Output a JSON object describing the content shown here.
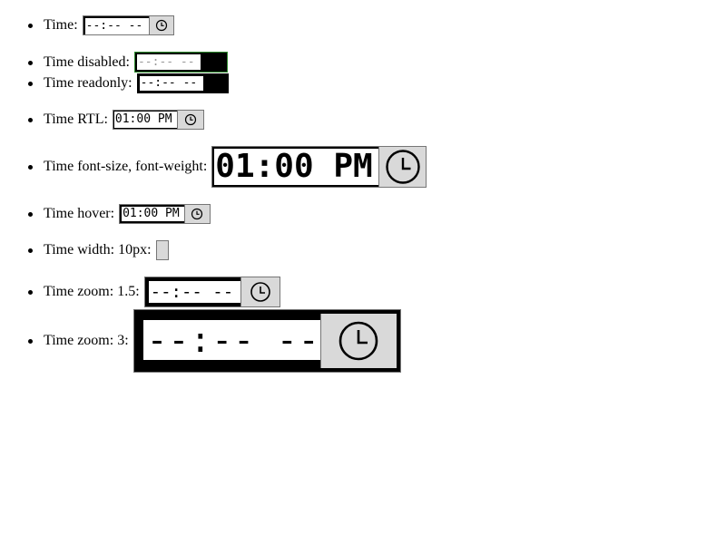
{
  "items": [
    {
      "label": "Time:",
      "value": "--:-- --",
      "icon": "clock-icon"
    },
    {
      "label": "Time disabled:",
      "value": "--:-- --"
    },
    {
      "label": "Time readonly:",
      "value": "--:-- --"
    },
    {
      "label": "Time RTL:",
      "value": "01:00 PM",
      "icon": "clock-icon"
    },
    {
      "label": "Time font-size, font-weight:",
      "value": "01:00 PM",
      "icon": "clock-icon"
    },
    {
      "label": "Time hover:",
      "value": "01:00 PM",
      "icon": "clock-icon"
    },
    {
      "label": "Time width: 10px:",
      "value": ""
    },
    {
      "label": "Time zoom: 1.5:",
      "value": "--:-- --",
      "icon": "clock-icon"
    },
    {
      "label": "Time zoom: 3:",
      "value": "--:-- --",
      "icon": "clock-icon"
    }
  ],
  "colors": {
    "field_background": "#ffffff",
    "picker_button": "#d9d9d9",
    "disabled_text": "#9a9a9a",
    "disabled_border": "#2e8b2e",
    "outer_border": "#000000"
  }
}
